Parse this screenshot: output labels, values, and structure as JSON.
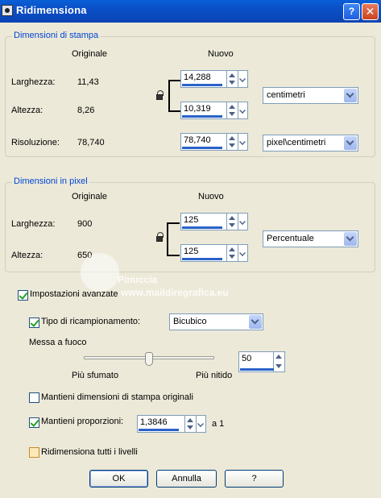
{
  "window": {
    "title": "Ridimensiona",
    "help_label": "?",
    "close_label": "✕",
    "icon": "app-icon",
    "colors": {
      "titlebar": "#0a4fc6",
      "legend": "#0046d5",
      "accent": "#2a62c9"
    }
  },
  "print_size": {
    "legend": "Dimensioni di stampa",
    "col_original": "Originale",
    "col_new": "Nuovo",
    "width": {
      "label": "Larghezza:",
      "original": "11,43",
      "new": "14,288"
    },
    "height": {
      "label": "Altezza:",
      "original": "8,26",
      "new": "10,319"
    },
    "resolution": {
      "label": "Risoluzione:",
      "original": "78,740",
      "new": "78,740"
    },
    "unit": "centimetri",
    "resolution_unit": "pixel\\centimetri"
  },
  "pixel_size": {
    "legend": "Dimensioni in pixel",
    "col_original": "Originale",
    "col_new": "Nuovo",
    "width": {
      "label": "Larghezza:",
      "original": "900",
      "new": "125"
    },
    "height": {
      "label": "Altezza:",
      "original": "650",
      "new": "125"
    },
    "unit": "Percentuale"
  },
  "advanced": {
    "label": "Impostazioni avanzate",
    "checked": true,
    "resample": {
      "label": "Tipo di ricampionamento:",
      "checked": true,
      "value": "Bicubico"
    },
    "sharpen": {
      "label": "Messa a fuoco",
      "value": "50",
      "min_label": "Più sfumato",
      "max_label": "Più nitido"
    },
    "keep_print": {
      "label": "Mantieni dimensioni di stampa originali",
      "checked": false
    },
    "keep_ratio": {
      "label": "Mantieni proporzioni:",
      "checked": true,
      "value": "1,3846",
      "suffix": "a 1"
    },
    "resize_all": {
      "label": "Ridimensiona tutti i livelli",
      "checked": false
    }
  },
  "buttons": {
    "ok": "OK",
    "cancel": "Annulla",
    "help": "?"
  },
  "watermark": {
    "name": "Pinuccia",
    "site": "www.maildiregrafica.eu"
  }
}
